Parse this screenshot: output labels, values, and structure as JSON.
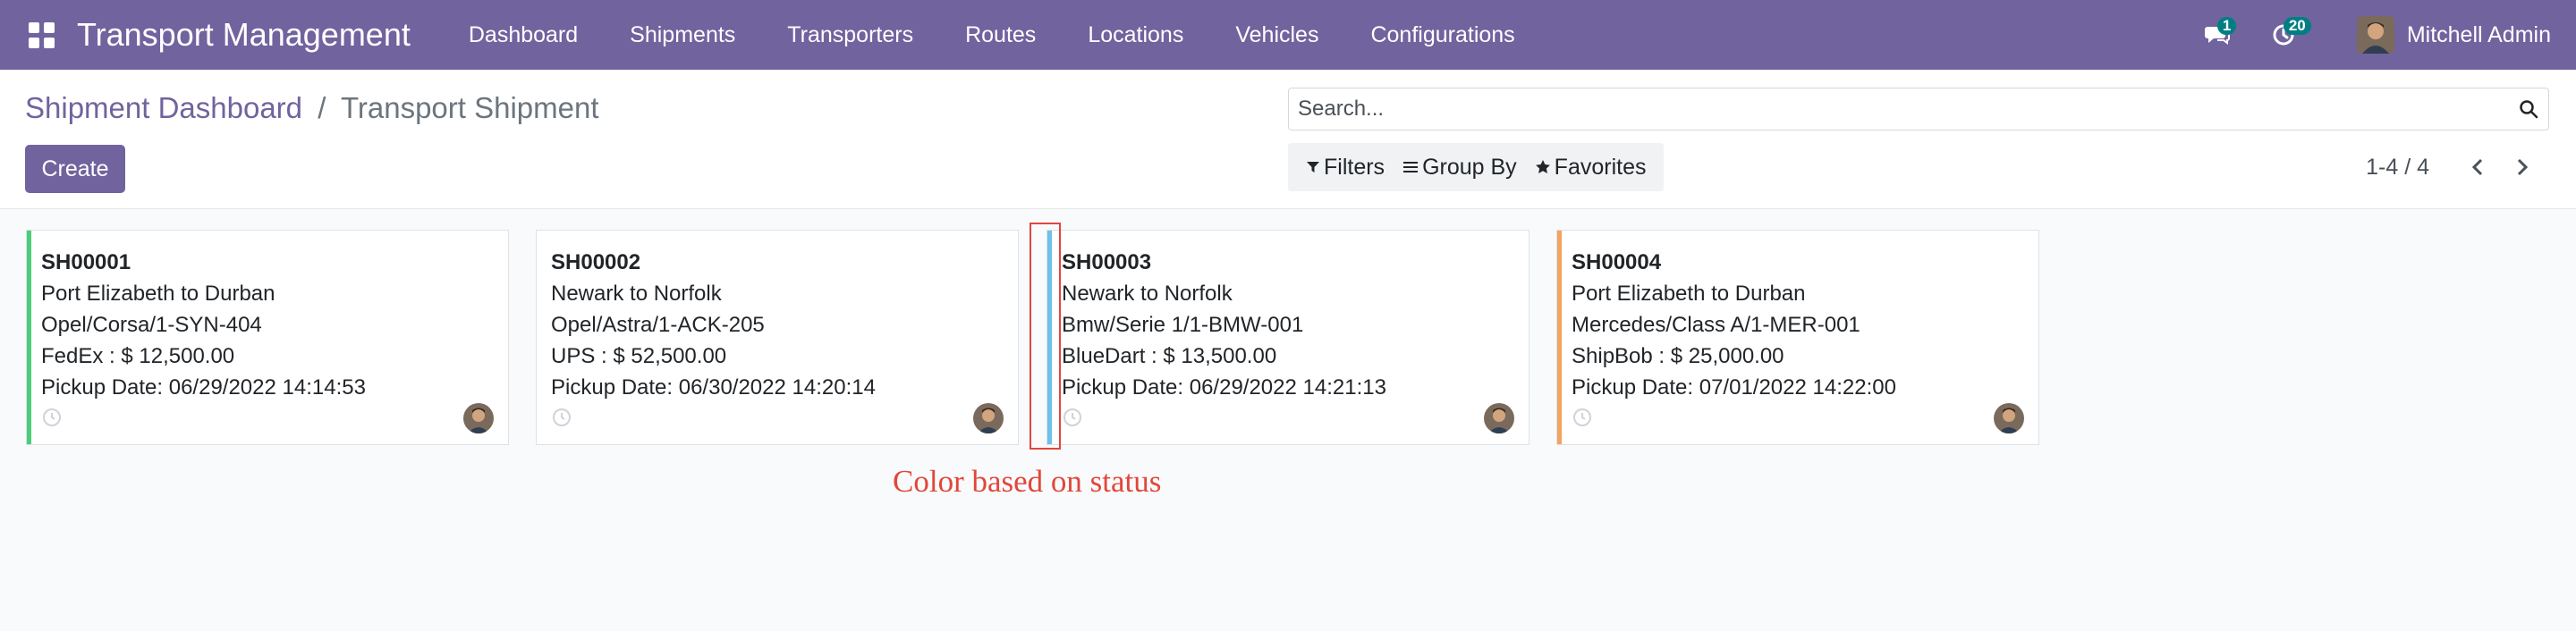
{
  "app": {
    "title": "Transport Management"
  },
  "menu": [
    "Dashboard",
    "Shipments",
    "Transporters",
    "Routes",
    "Locations",
    "Vehicles",
    "Configurations"
  ],
  "systray": {
    "messages_count": "1",
    "activities_count": "20",
    "user_name": "Mitchell Admin"
  },
  "breadcrumb": {
    "parent": "Shipment Dashboard",
    "separator": "/",
    "current": "Transport Shipment"
  },
  "actions": {
    "create_label": "Create"
  },
  "search": {
    "placeholder": "Search..."
  },
  "filters": {
    "filters_label": "Filters",
    "groupby_label": "Group By",
    "favorites_label": "Favorites"
  },
  "pager": {
    "value": "1-4 / 4"
  },
  "cards": [
    {
      "ref": "SH00001",
      "route": "Port Elizabeth to Durban",
      "vehicle": "Opel/Corsa/1-SYN-404",
      "transporter_cost": "FedEx : $ 12,500.00",
      "pickup": "Pickup Date: 06/29/2022 14:14:53",
      "status_color": "#4ccd7a"
    },
    {
      "ref": "SH00002",
      "route": "Newark to Norfolk",
      "vehicle": "Opel/Astra/1-ACK-205",
      "transporter_cost": "UPS : $ 52,500.00",
      "pickup": "Pickup Date: 06/30/2022 14:20:14",
      "status_color": "#ffffff"
    },
    {
      "ref": "SH00003",
      "route": "Newark to Norfolk",
      "vehicle": "Bmw/Serie 1/1-BMW-001",
      "transporter_cost": "BlueDart : $ 13,500.00",
      "pickup": "Pickup Date: 06/29/2022 14:21:13",
      "status_color": "#6cc1ed"
    },
    {
      "ref": "SH00004",
      "route": "Port Elizabeth to Durban",
      "vehicle": "Mercedes/Class A/1-MER-001",
      "transporter_cost": "ShipBob : $ 25,000.00",
      "pickup": "Pickup Date: 07/01/2022 14:22:00",
      "status_color": "#f4a460"
    }
  ],
  "annotation": {
    "text": "Color based on status"
  },
  "colors": {
    "navbar": "#71639e",
    "primary": "#71639e",
    "annotation": "#e2463b"
  }
}
